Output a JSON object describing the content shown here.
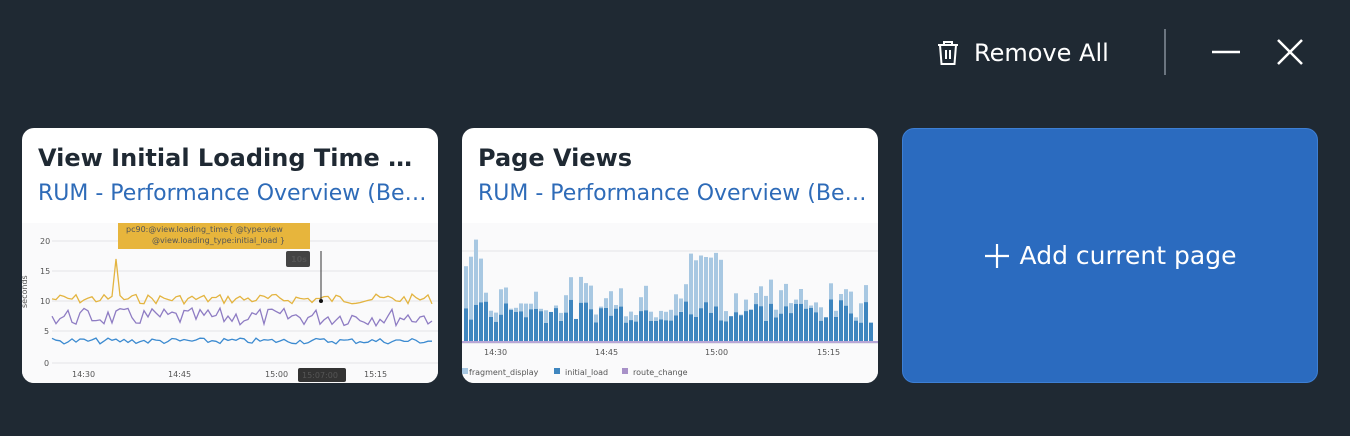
{
  "toolbar": {
    "remove_all_label": "Remove All",
    "icons": [
      "trash-icon",
      "minimize-icon",
      "close-icon"
    ]
  },
  "cards": [
    {
      "title": "View Initial Loading Time Metrics",
      "subtitle": "RUM - Performance Overview (Beta)",
      "thumbnail": {
        "tooltip_line1": "pc90:@view.loading_time{ @type:view",
        "tooltip_line2": "@view.loading_type:initial_load }",
        "value_badge": "10s",
        "time_badge": "15:07:00",
        "y_ticks": [
          "20",
          "15",
          "10",
          "5",
          "0"
        ],
        "x_ticks": [
          "14:30",
          "14:45",
          "15:00",
          "15:15"
        ],
        "y_axis_label": "seconds"
      }
    },
    {
      "title": "Page Views",
      "subtitle": "RUM - Performance Overview (Beta)",
      "thumbnail": {
        "x_ticks": [
          "14:30",
          "14:45",
          "15:00",
          "15:15"
        ],
        "legend": [
          "fragment_display",
          "initial_load",
          "route_change"
        ]
      }
    }
  ],
  "add_card": {
    "label": "Add current page"
  },
  "colors": {
    "background": "#1f2933",
    "accent": "#2b6bbf",
    "link": "#2e6bb8",
    "series_yellow": "#e3b440",
    "series_purple": "#8e7cc3",
    "series_blue": "#3b8ad0",
    "bar_light": "#a8c8e2",
    "bar_dark": "#3f86bf"
  }
}
